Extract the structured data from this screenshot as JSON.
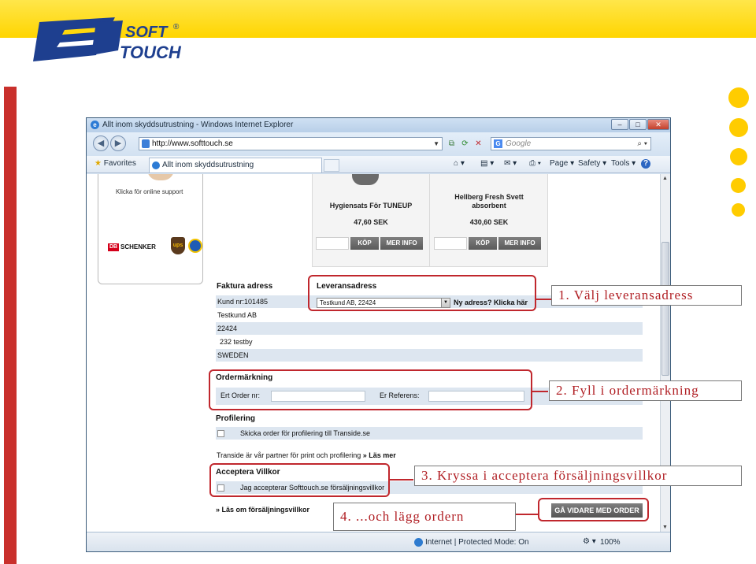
{
  "brand": {
    "logo_text_line1": "SOFT",
    "logo_text_line2": "TOUCH",
    "registered": "®",
    "logo_color": "#1e3f8f",
    "band_color": "#ffd500",
    "accent_red": "#c9302c",
    "dot_color": "#ffcc00"
  },
  "browser": {
    "title": "Allt inom skyddsutrustning - Windows Internet Explorer",
    "url": "http://www.softtouch.se",
    "search_placeholder": "Google",
    "favorites_label": "Favorites",
    "tab_label": "Allt inom skyddsutrustning",
    "commands": [
      "Page ▾",
      "Safety ▾",
      "Tools ▾"
    ],
    "help_icon": "?",
    "status_zone": "Internet | Protected Mode: On",
    "zoom": "100%",
    "icons": [
      "back-icon",
      "forward-icon",
      "refresh-icon",
      "stop-icon",
      "search-icon",
      "home-icon",
      "feeds-icon",
      "mail-icon",
      "print-icon"
    ]
  },
  "page": {
    "support_text": "Klicka för online support",
    "carriers": {
      "db": "DB",
      "schenker": "SCHENKER",
      "ups": "ups"
    },
    "products": [
      {
        "name": "Hygiensats För TUNEUP",
        "price": "47,60  SEK",
        "buy": "KÖP",
        "info": "MER INFO"
      },
      {
        "name_line1": "Hellberg Fresh Svett",
        "name_line2": "absorbent",
        "price": "430,60  SEK",
        "buy": "KÖP",
        "info": "MER INFO"
      }
    ],
    "invoice": {
      "heading": "Faktura adress",
      "customer_no": "Kund nr:101485",
      "lines": [
        "Testkund AB",
        "22424",
        "232 testby",
        "SWEDEN"
      ]
    },
    "delivery": {
      "heading": "Leveransadress",
      "selected": "Testkund AB,  22424",
      "new_address": "Ny adress? Klicka här"
    },
    "order_marking": {
      "heading": "Ordermärkning",
      "your_order_label": "Ert Order nr:",
      "your_reference_label": "Er Referens:"
    },
    "profiling": {
      "heading": "Profilering",
      "checkbox_label": "Skicka order för profilering till Transide.se",
      "partner_text": "Transide är vår partner för print och profilering",
      "partner_link": "» Läs mer"
    },
    "terms": {
      "heading": "Acceptera Villkor",
      "checkbox_label": "Jag accepterar Softtouch.se försäljningsvillkor",
      "link": "» Läs om försäljningsvillkor"
    },
    "submit_button": "GÅ VIDARE MED ORDER"
  },
  "callouts": {
    "step1": "1. Välj leveransadress",
    "step2": "2. Fyll i ordermärkning",
    "step3": "3. Kryssa  i acceptera försäljningsvillkor",
    "step4": "4. ...och lägg ordern"
  }
}
